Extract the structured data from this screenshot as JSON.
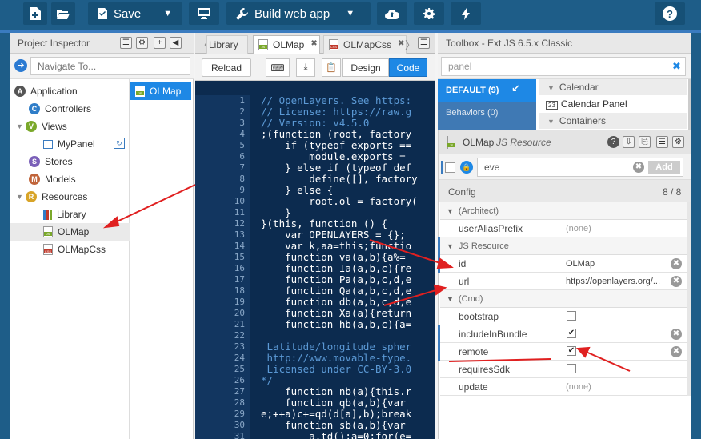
{
  "toolbar": {
    "save_label": "Save",
    "build_label": "Build web app"
  },
  "project_inspector": {
    "title": "Project Inspector",
    "navigate_placeholder": "Navigate To...",
    "tree": {
      "application": "Application",
      "controllers": "Controllers",
      "views": "Views",
      "mypanel": "MyPanel",
      "stores": "Stores",
      "models": "Models",
      "resources": "Resources",
      "library": "Library",
      "olmap": "OLMap",
      "olmapcss": "OLMapCss"
    },
    "selected_item": "OLMap"
  },
  "editor": {
    "tabs": [
      "Library",
      "OLMap",
      "OLMapCss"
    ],
    "reload_label": "Reload",
    "design_label": "Design",
    "code_label": "Code",
    "line_numbers": [
      "1",
      "2",
      "3",
      "4",
      "5",
      "6",
      "7",
      "8",
      "9",
      "10",
      "11",
      "12",
      "13",
      "14",
      "15",
      "16",
      "17",
      "18",
      "19",
      "20",
      "21",
      "22",
      "23",
      "24",
      "25",
      "26",
      "27",
      "28",
      "29",
      "30",
      "31"
    ],
    "code_lines": [
      "// OpenLayers. See https:",
      "// License: https://raw.g",
      "// Version: v4.5.0",
      ";(function (root, factory",
      "    if (typeof exports ==",
      "        module.exports =",
      "    } else if (typeof def",
      "        define([], factory",
      "    } else {",
      "        root.ol = factory(",
      "    }",
      "}(this, function () {",
      "    var OPENLAYERS = {};",
      "    var k,aa=this;functio",
      "    function va(a,b){a%=",
      "    function Ia(a,b,c){re",
      "    function Pa(a,b,c,d,e",
      "    function Qa(a,b,c,d,e",
      "    function db(a,b,c,d,e",
      "    function Xa(a){return",
      "    function hb(a,b,c){a=",
      "",
      " Latitude/longitude spher",
      " http://www.movable-type.",
      " Licensed under CC-BY-3.0",
      "*/",
      "    function nb(a){this.r",
      "    function qb(a,b){var ",
      "e;++a)c+=qd(d[a],b);break",
      "    function sb(a,b){var ",
      "        a.td();a=0;for(e="
    ]
  },
  "toolbox": {
    "title": "Toolbox - Ext JS 6.5.x Classic",
    "search_value": "panel",
    "categories": [
      "DEFAULT (9)",
      "Behaviors (0)"
    ],
    "items": [
      "Calendar",
      "Calendar Panel",
      "Containers"
    ]
  },
  "resource": {
    "title": "OLMap",
    "subtitle": "JS Resource",
    "filter_value": "eve",
    "add_label": "Add",
    "config_label": "Config",
    "config_count": "8 / 8",
    "groups": [
      "(Architect)",
      "JS Resource",
      "(Cmd)"
    ],
    "rows": {
      "userAliasPrefix": {
        "name": "userAliasPrefix",
        "value": "(none)"
      },
      "id": {
        "name": "id",
        "value": "OLMap"
      },
      "url": {
        "name": "url",
        "value": "https://openlayers.org/..."
      },
      "bootstrap": {
        "name": "bootstrap",
        "checked": false
      },
      "includeInBundle": {
        "name": "includeInBundle",
        "checked": true
      },
      "remote": {
        "name": "remote",
        "checked": true
      },
      "requiresSdk": {
        "name": "requiresSdk",
        "checked": false
      },
      "update": {
        "name": "update",
        "value": "(none)"
      }
    }
  },
  "colors": {
    "toolbar": "#1e5d88",
    "accent": "#3a7bbf",
    "selected": "#1e88e5",
    "annotation": "#e02020"
  }
}
